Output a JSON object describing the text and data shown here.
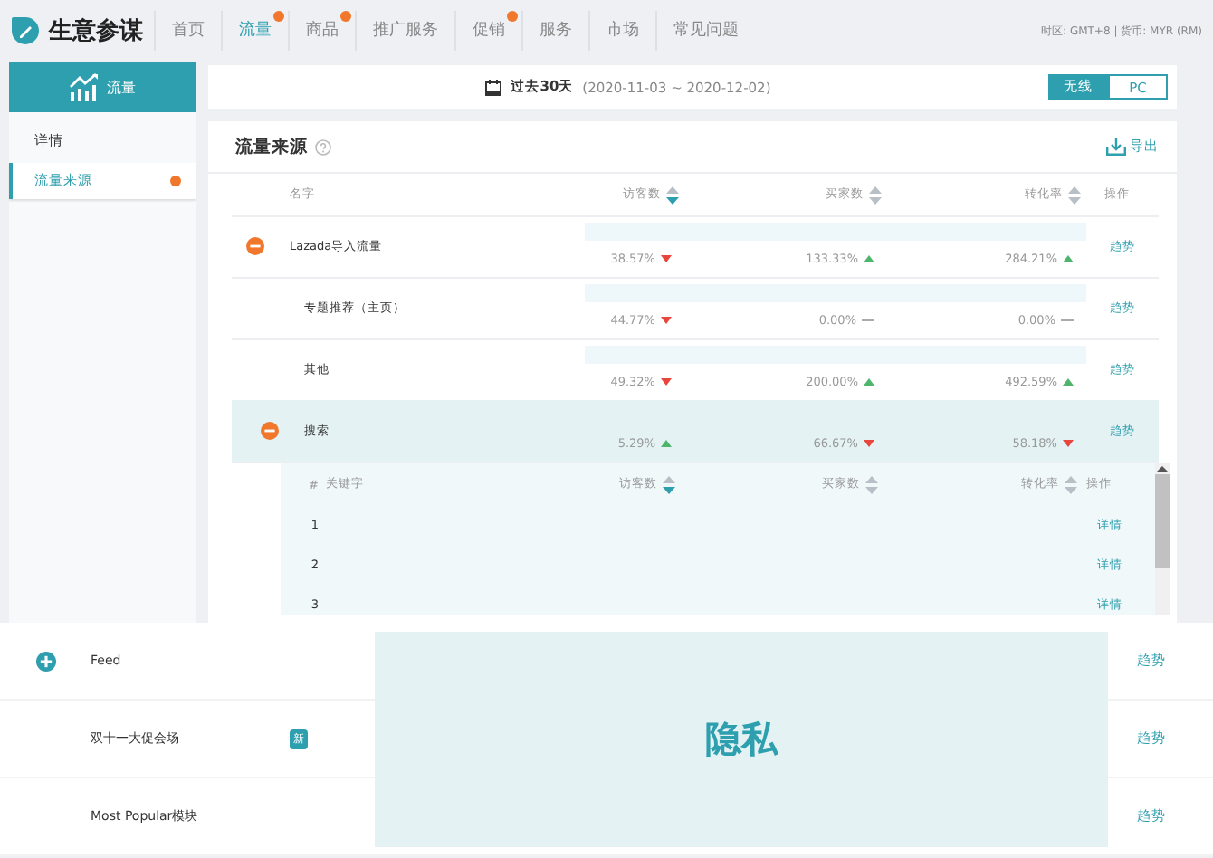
{
  "app": {
    "name": "生意参谋"
  },
  "nav": [
    {
      "label": "首页",
      "selected": false,
      "dot": false
    },
    {
      "label": "流量",
      "selected": true,
      "dot": true
    },
    {
      "label": "商品",
      "selected": false,
      "dot": true
    },
    {
      "label": "推广服务",
      "selected": false,
      "dot": false
    },
    {
      "label": "促销",
      "selected": false,
      "dot": true
    },
    {
      "label": "服务",
      "selected": false,
      "dot": false
    },
    {
      "label": "市场",
      "selected": false,
      "dot": false
    },
    {
      "label": "常见问题",
      "selected": false,
      "dot": false
    }
  ],
  "locale": "时区: GMT+8 | 货币: MYR (RM)",
  "sidebar": {
    "header": "流量",
    "items": [
      {
        "label": "详情",
        "selected": false,
        "dot": false
      },
      {
        "label": "流量来源",
        "selected": true,
        "dot": true
      }
    ]
  },
  "date_bar": {
    "range_label": "过去30天",
    "range": "(2020-11-03 ~ 2020-12-02)",
    "toggle": [
      {
        "label": "无线",
        "selected": true
      },
      {
        "label": "PC",
        "selected": false
      }
    ]
  },
  "panel": {
    "title": "流量来源",
    "export": "导出",
    "columns": [
      {
        "label": "名字"
      },
      {
        "label": "访客数",
        "sorted": true
      },
      {
        "label": "买家数",
        "sorted": false
      },
      {
        "label": "转化率",
        "sorted": false
      },
      {
        "label": "操作"
      }
    ],
    "rows": [
      {
        "expanded": true,
        "selected": false,
        "cells": [
          {
            "text": "Lazada导入流量",
            "kind": "name"
          },
          {
            "text": "38.57%",
            "kind": "down"
          },
          {
            "text": "133.33%",
            "kind": "up"
          },
          {
            "text": "284.21%",
            "kind": "up"
          },
          {
            "text": "趋势",
            "kind": "link"
          }
        ],
        "children": [
          {
            "selected": false,
            "cells": [
              {
                "text": "专题推荐（主页）",
                "kind": "name"
              },
              {
                "text": "44.77%",
                "kind": "down"
              },
              {
                "text": "0.00%",
                "kind": "flat"
              },
              {
                "text": "0.00%",
                "kind": "flat"
              },
              {
                "text": "趋势",
                "kind": "link"
              }
            ]
          },
          {
            "selected": false,
            "cells": [
              {
                "text": "其他",
                "kind": "name"
              },
              {
                "text": "49.32%",
                "kind": "down"
              },
              {
                "text": "200.00%",
                "kind": "up"
              },
              {
                "text": "492.59%",
                "kind": "up"
              },
              {
                "text": "趋势",
                "kind": "link"
              }
            ]
          },
          {
            "expanded": true,
            "selected": true,
            "cells": [
              {
                "text": "搜索",
                "kind": "name"
              },
              {
                "text": "5.29%",
                "kind": "up"
              },
              {
                "text": "66.67%",
                "kind": "down"
              },
              {
                "text": "58.18%",
                "kind": "down"
              },
              {
                "text": "趋势",
                "kind": "link"
              }
            ],
            "keywords": {
              "columns": [
                {
                  "label": "#"
                },
                {
                  "label": "关键字"
                },
                {
                  "label": "访客数",
                  "sorted": true
                },
                {
                  "label": "买家数",
                  "sorted": false
                },
                {
                  "label": "转化率",
                  "sorted": false
                },
                {
                  "label": "操作"
                }
              ],
              "rows": [
                {
                  "cells": [
                    {
                      "text": "1",
                      "kind": "index"
                    },
                    {
                      "text": "",
                      "kind": "empty"
                    },
                    {
                      "text": "",
                      "kind": "empty"
                    },
                    {
                      "text": "",
                      "kind": "empty"
                    },
                    {
                      "text": "",
                      "kind": "empty"
                    },
                    {
                      "text": "详情",
                      "kind": "link"
                    }
                  ]
                },
                {
                  "cells": [
                    {
                      "text": "2",
                      "kind": "index"
                    },
                    {
                      "text": "",
                      "kind": "empty"
                    },
                    {
                      "text": "",
                      "kind": "empty"
                    },
                    {
                      "text": "",
                      "kind": "empty"
                    },
                    {
                      "text": "",
                      "kind": "empty"
                    },
                    {
                      "text": "详情",
                      "kind": "link"
                    }
                  ]
                },
                {
                  "cells": [
                    {
                      "text": "3",
                      "kind": "index"
                    },
                    {
                      "text": "",
                      "kind": "empty"
                    },
                    {
                      "text": "",
                      "kind": "empty"
                    },
                    {
                      "text": "",
                      "kind": "empty"
                    },
                    {
                      "text": "",
                      "kind": "empty"
                    },
                    {
                      "text": "详情",
                      "kind": "link"
                    }
                  ]
                }
              ]
            }
          }
        ]
      }
    ]
  },
  "zoom_panel": {
    "rows": [
      {
        "name": "Feed",
        "expanded": false,
        "action": "趋势"
      },
      {
        "name": "双十一大促会场",
        "badge": "新",
        "action": "趋势"
      },
      {
        "name": "Most Popular模块",
        "action": "趋势"
      }
    ],
    "privacy": "隐私"
  }
}
